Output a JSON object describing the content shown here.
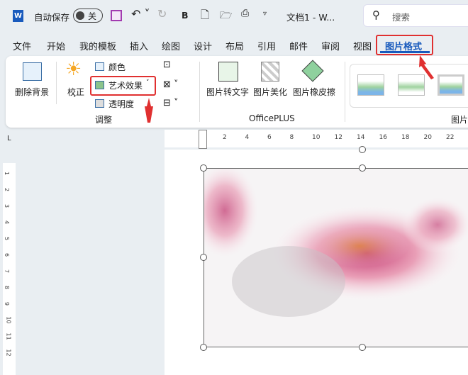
{
  "titlebar": {
    "autosave_label": "自动保存",
    "autosave_state": "关",
    "doc_title": "文档1  -  W...",
    "search_placeholder": "搜索",
    "bold": "B"
  },
  "tabs": [
    "文件",
    "开始",
    "我的模板",
    "插入",
    "绘图",
    "设计",
    "布局",
    "引用",
    "邮件",
    "审阅",
    "视图",
    "图片格式"
  ],
  "active_tab": "图片格式",
  "ribbon": {
    "remove_bg": "删除背景",
    "corrections": "校正",
    "color": "颜色",
    "artistic_effects": "艺术效果",
    "transparency": "透明度",
    "group_adjust": "调整",
    "pic_to_text": "图片转文字",
    "pic_beautify": "图片美化",
    "pic_eraser": "图片橡皮擦",
    "group_officeplus": "OfficePLUS",
    "group_styles": "图片样式"
  },
  "ruler": {
    "h_ticks": [
      "2",
      "4",
      "6",
      "8",
      "10",
      "12",
      "14",
      "16",
      "18",
      "20",
      "22"
    ],
    "v_ticks": [
      "1",
      "2",
      "3",
      "4",
      "5",
      "6",
      "7",
      "8",
      "9",
      "10",
      "11",
      "12"
    ]
  },
  "colors": {
    "accent": "#185abd",
    "highlight": "#e03030"
  }
}
